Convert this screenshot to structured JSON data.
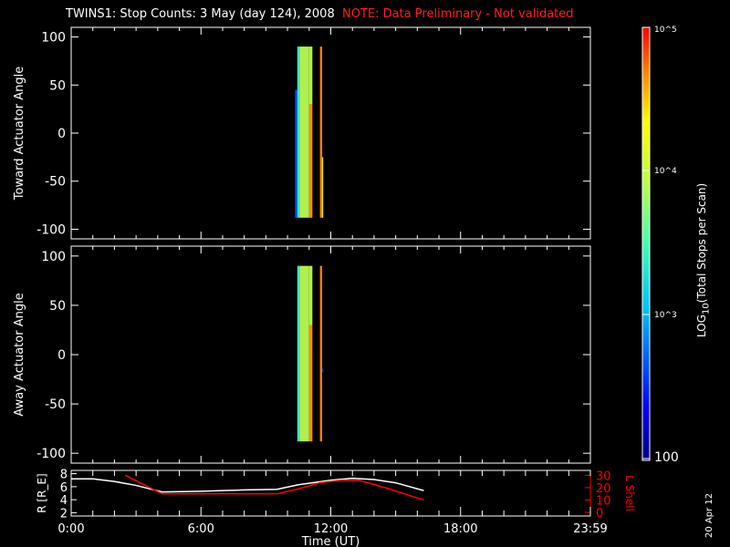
{
  "title": "TWINS1: Stop Counts:  3 May (day 124), 2008",
  "note": "NOTE: Data Preliminary - Not validated",
  "colors": {
    "note": "#ff2020",
    "lshell": "#ff0000",
    "axis": "#ffffff"
  },
  "chart_data": [
    {
      "type": "heatmap",
      "ylabel": "Toward Actuator Angle",
      "ylim": [
        -110,
        110
      ],
      "yticks": [
        100,
        50,
        0,
        -50,
        -100
      ],
      "xlim": [
        0,
        24
      ],
      "bands": [
        {
          "t0": 10.35,
          "t1": 10.45,
          "a0": -88,
          "a1": 45,
          "color": "#0050ff"
        },
        {
          "t0": 10.45,
          "t1": 10.55,
          "a0": -88,
          "a1": 90,
          "color": "#40e0c0"
        },
        {
          "t0": 10.55,
          "t1": 11.0,
          "a0": -88,
          "a1": 90,
          "color": "#b0f050"
        },
        {
          "t0": 11.0,
          "t1": 11.15,
          "a0": -88,
          "a1": 30,
          "color": "#ff9000"
        },
        {
          "t0": 11.0,
          "t1": 11.15,
          "a0": 30,
          "a1": 90,
          "color": "#b0f050"
        },
        {
          "t0": 11.5,
          "t1": 11.6,
          "a0": -88,
          "a1": 90,
          "color": "#ff8000"
        },
        {
          "t0": 11.6,
          "t1": 11.65,
          "a0": -88,
          "a1": -25,
          "color": "#e0f020"
        }
      ]
    },
    {
      "type": "heatmap",
      "ylabel": "Away Actuator Angle",
      "ylim": [
        -110,
        110
      ],
      "yticks": [
        100,
        50,
        0,
        -50,
        -100
      ],
      "xlim": [
        0,
        24
      ],
      "bands": [
        {
          "t0": 10.45,
          "t1": 10.55,
          "a0": -88,
          "a1": 90,
          "color": "#40e0c0"
        },
        {
          "t0": 10.55,
          "t1": 11.0,
          "a0": -88,
          "a1": 90,
          "color": "#b0f050"
        },
        {
          "t0": 11.0,
          "t1": 11.15,
          "a0": -88,
          "a1": 30,
          "color": "#ff9000"
        },
        {
          "t0": 11.0,
          "t1": 11.15,
          "a0": 30,
          "a1": 90,
          "color": "#b0f050"
        },
        {
          "t0": 11.5,
          "t1": 11.6,
          "a0": -88,
          "a1": 90,
          "color": "#ff8000"
        },
        {
          "t0": 11.6,
          "t1": 11.65,
          "a0": -18,
          "a1": -14,
          "color": "#2020ff"
        }
      ]
    },
    {
      "type": "line",
      "ylabel": "R [R_E]",
      "y2label": "L Shell",
      "xlabel": "Time (UT)",
      "xticks": [
        "0:00",
        "6:00",
        "12:00",
        "18:00",
        "23:59"
      ],
      "xtick_hours": [
        0,
        6,
        12,
        18,
        24
      ],
      "yticks": [
        8,
        6,
        4,
        2
      ],
      "y2ticks": [
        30,
        20,
        10,
        0
      ],
      "ylim": [
        1.5,
        8.5
      ],
      "y2lim": [
        0,
        31
      ],
      "series": [
        {
          "name": "R",
          "color": "#ffffff",
          "x": [
            0,
            1,
            2,
            3,
            4.2,
            6,
            8,
            9.5,
            10.5,
            12,
            13,
            14,
            15,
            16.3
          ],
          "y": [
            7.2,
            7.2,
            6.8,
            6.2,
            5.2,
            5.3,
            5.5,
            5.6,
            6.3,
            7,
            7.3,
            7.1,
            6.6,
            5.4
          ]
        },
        {
          "name": "L Shell",
          "color": "#ff0000",
          "x": [
            2.5,
            4.2,
            6,
            9.5,
            10.5,
            11.5,
            12.5,
            13.3,
            14.5,
            16.3
          ],
          "y": [
            30,
            15,
            15,
            15,
            19,
            24,
            26,
            26,
            20,
            10
          ]
        }
      ]
    }
  ],
  "colorbar": {
    "label": "LOG10(Total Stops per Scan)",
    "ticks": [
      "10^5",
      "10^4",
      "10^3",
      "100"
    ]
  },
  "date_stamp": "20 Apr 12"
}
